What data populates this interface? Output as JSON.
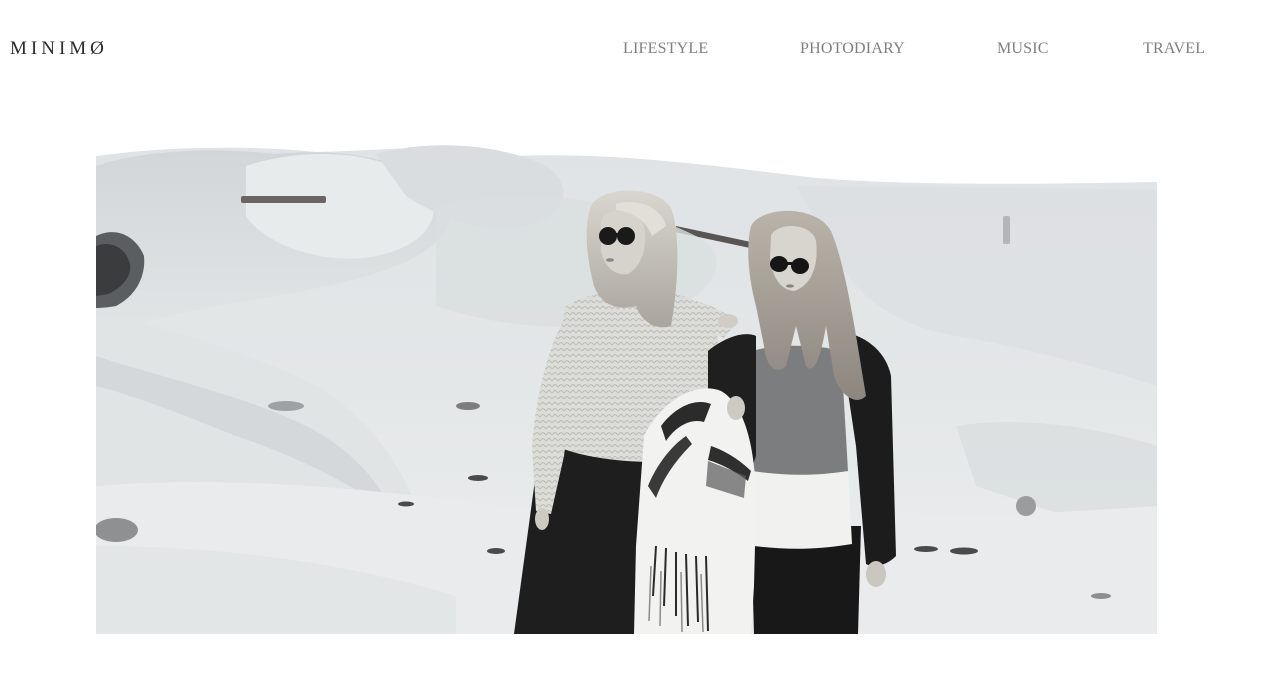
{
  "header": {
    "logo": "MINIMØ"
  },
  "nav": {
    "items": [
      {
        "label": "LIFESTYLE"
      },
      {
        "label": "PHOTODIARY"
      },
      {
        "label": "MUSIC"
      },
      {
        "label": "TRAVEL"
      }
    ]
  },
  "hero": {
    "style": "black-and-white photograph",
    "colors": {
      "sky": "#ffffff",
      "sand_light": "#e6e9ea",
      "sand_mid": "#d4d8da",
      "sand_shadow": "#bfc4c6",
      "dark": "#1c1c1c"
    }
  }
}
